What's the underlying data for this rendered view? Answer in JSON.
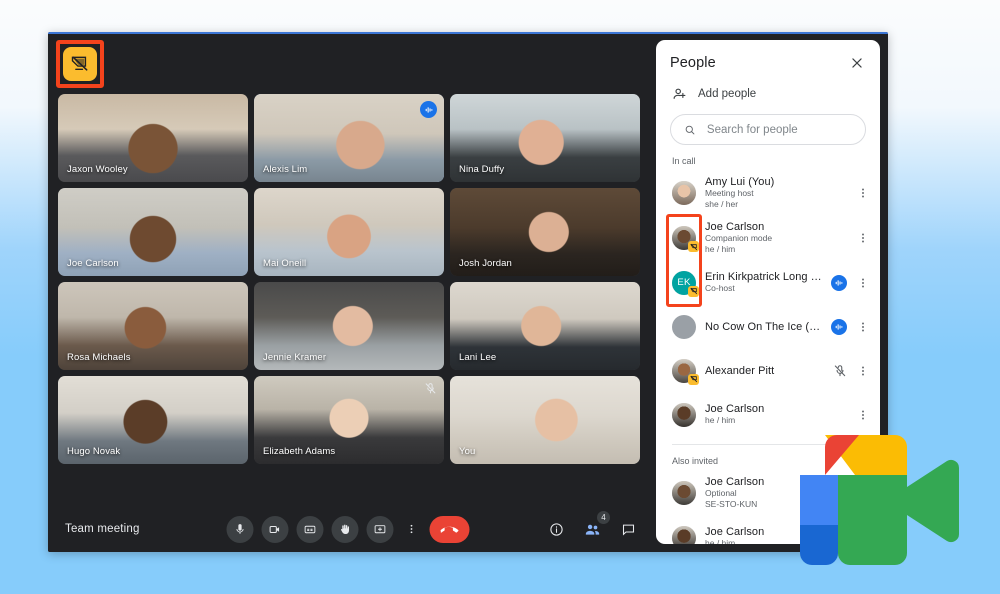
{
  "window": {
    "companion_badge_icon": "present-off-icon",
    "meeting_title": "Team meeting"
  },
  "stage": {
    "tiles": [
      {
        "name": "Jaxon Wooley",
        "speaking": false,
        "muted": false,
        "fill": "f1"
      },
      {
        "name": "Alexis Lim",
        "speaking": true,
        "muted": false,
        "fill": "f2"
      },
      {
        "name": "Nina Duffy",
        "speaking": false,
        "muted": false,
        "fill": "f3"
      },
      {
        "name": "Joe Carlson",
        "speaking": false,
        "muted": false,
        "fill": "f4"
      },
      {
        "name": "Mai Oneill",
        "speaking": false,
        "muted": false,
        "fill": "f5"
      },
      {
        "name": "Josh Jordan",
        "speaking": false,
        "muted": false,
        "fill": "f6"
      },
      {
        "name": "Rosa Michaels",
        "speaking": false,
        "muted": false,
        "fill": "f7"
      },
      {
        "name": "Jennie Kramer",
        "speaking": false,
        "muted": false,
        "fill": "f8"
      },
      {
        "name": "Lani Lee",
        "speaking": false,
        "muted": false,
        "fill": "f9"
      },
      {
        "name": "Hugo Novak",
        "speaking": false,
        "muted": false,
        "fill": "f10"
      },
      {
        "name": "Elizabeth Adams",
        "speaking": false,
        "muted": true,
        "fill": "f11"
      },
      {
        "name": "You",
        "speaking": false,
        "muted": false,
        "fill": "f12"
      }
    ]
  },
  "toolbar": {
    "title": "Team meeting",
    "controls": [
      {
        "name": "microphone-button",
        "icon": "microphone-icon"
      },
      {
        "name": "camera-button",
        "icon": "camera-icon"
      },
      {
        "name": "captions-button",
        "icon": "captions-icon"
      },
      {
        "name": "raise-hand-button",
        "icon": "hand-icon"
      },
      {
        "name": "present-now-button",
        "icon": "present-icon"
      },
      {
        "name": "more-options-button",
        "icon": "more-vertical-icon"
      },
      {
        "name": "leave-call-button",
        "icon": "end-call-icon"
      }
    ],
    "right_controls": [
      {
        "name": "meeting-details-button",
        "icon": "info-icon",
        "badge": ""
      },
      {
        "name": "show-everyone-button",
        "icon": "people-icon",
        "badge": "4",
        "active": true
      },
      {
        "name": "chat-button",
        "icon": "chat-icon",
        "badge": ""
      }
    ]
  },
  "people_panel": {
    "title": "People",
    "close_label": "close-icon",
    "add_people_label": "Add people",
    "search": {
      "placeholder": "Search for people",
      "value": ""
    },
    "sections": [
      {
        "label": "In call",
        "participants": [
          {
            "name": "Amy Lui (You)",
            "sub1": "Meeting host",
            "sub2": "she / her",
            "avatar_type": "photo",
            "avatar_fill": "a1",
            "companion": false,
            "speaking": false,
            "muted": false
          },
          {
            "name": "Joe Carlson",
            "sub1": "Companion mode",
            "sub2": "he / him",
            "avatar_type": "photo",
            "avatar_fill": "a2",
            "companion": true,
            "speaking": false,
            "muted": false
          },
          {
            "name": "Erin Kirkpatrick Long nam...",
            "sub1": "Co-host",
            "sub2": "",
            "avatar_type": "initials",
            "avatar_initials": "EK",
            "avatar_color": "#00a3a1",
            "companion": true,
            "speaking": true,
            "muted": false
          },
          {
            "name": "No Cow On The Ice (se-sto...",
            "sub1": "",
            "sub2": "",
            "avatar_type": "blank",
            "avatar_color": "#9aa0a6",
            "companion": false,
            "speaking": true,
            "muted": false
          },
          {
            "name": "Alexander Pitt",
            "sub1": "",
            "sub2": "",
            "avatar_type": "photo",
            "avatar_fill": "a3",
            "companion": true,
            "speaking": false,
            "muted": true
          },
          {
            "name": "Joe Carlson",
            "sub1": "he / him",
            "sub2": "",
            "avatar_type": "photo",
            "avatar_fill": "a4",
            "companion": false,
            "speaking": false,
            "muted": false
          }
        ]
      },
      {
        "label": "Also invited",
        "participants": [
          {
            "name": "Joe Carlson",
            "sub1": "Optional",
            "sub2": "SE-STO-KUN",
            "avatar_type": "photo",
            "avatar_fill": "a2",
            "companion": false,
            "speaking": false,
            "muted": false
          },
          {
            "name": "Joe Carlson",
            "sub1": "he / him",
            "sub2": "",
            "avatar_type": "photo",
            "avatar_fill": "a4",
            "companion": false,
            "speaking": false,
            "muted": false
          }
        ]
      }
    ]
  },
  "colors": {
    "highlight": "#f4431c",
    "companion_yellow": "#fbbc2e",
    "accent_blue": "#1a73e8",
    "speaking_outline": "#8ab4f8",
    "hangup_red": "#ea4335",
    "panel_bg": "#ffffff",
    "window_bg": "#202124"
  },
  "logo": {
    "name": "google-meet-logo",
    "yellow": "#fbbc04",
    "red": "#ea4335",
    "blue": "#4285f4",
    "blue_dark": "#1967d2",
    "green": "#34a853"
  }
}
